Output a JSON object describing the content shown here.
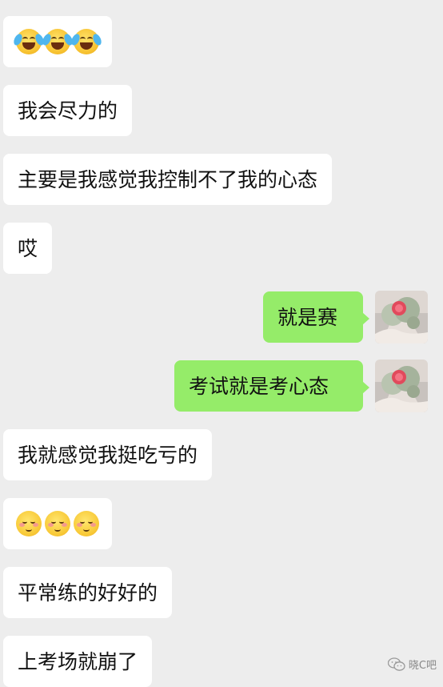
{
  "chat": {
    "messages": [
      {
        "side": "incoming",
        "type": "emoji",
        "emoji": "tears-of-joy-face",
        "count": 3
      },
      {
        "side": "incoming",
        "type": "text",
        "text": "我会尽力的"
      },
      {
        "side": "incoming",
        "type": "text",
        "text": "主要是我感觉我控制不了我的心态"
      },
      {
        "side": "incoming",
        "type": "text",
        "text": "哎"
      },
      {
        "side": "outgoing",
        "type": "text",
        "text": "就是赛"
      },
      {
        "side": "outgoing",
        "type": "text",
        "text": "考试就是考心态"
      },
      {
        "side": "incoming",
        "type": "text",
        "text": "我就感觉我挺吃亏的"
      },
      {
        "side": "incoming",
        "type": "emoji",
        "emoji": "blushing-face",
        "count": 3
      },
      {
        "side": "incoming",
        "type": "text",
        "text": "平常练的好好的"
      },
      {
        "side": "incoming",
        "type": "text",
        "text": "上考场就崩了"
      }
    ]
  },
  "watermark": {
    "text": "晓C吧",
    "icon": "wechat-icon"
  },
  "colors": {
    "background": "#ededed",
    "incoming_bubble": "#ffffff",
    "outgoing_bubble": "#95ec69"
  }
}
